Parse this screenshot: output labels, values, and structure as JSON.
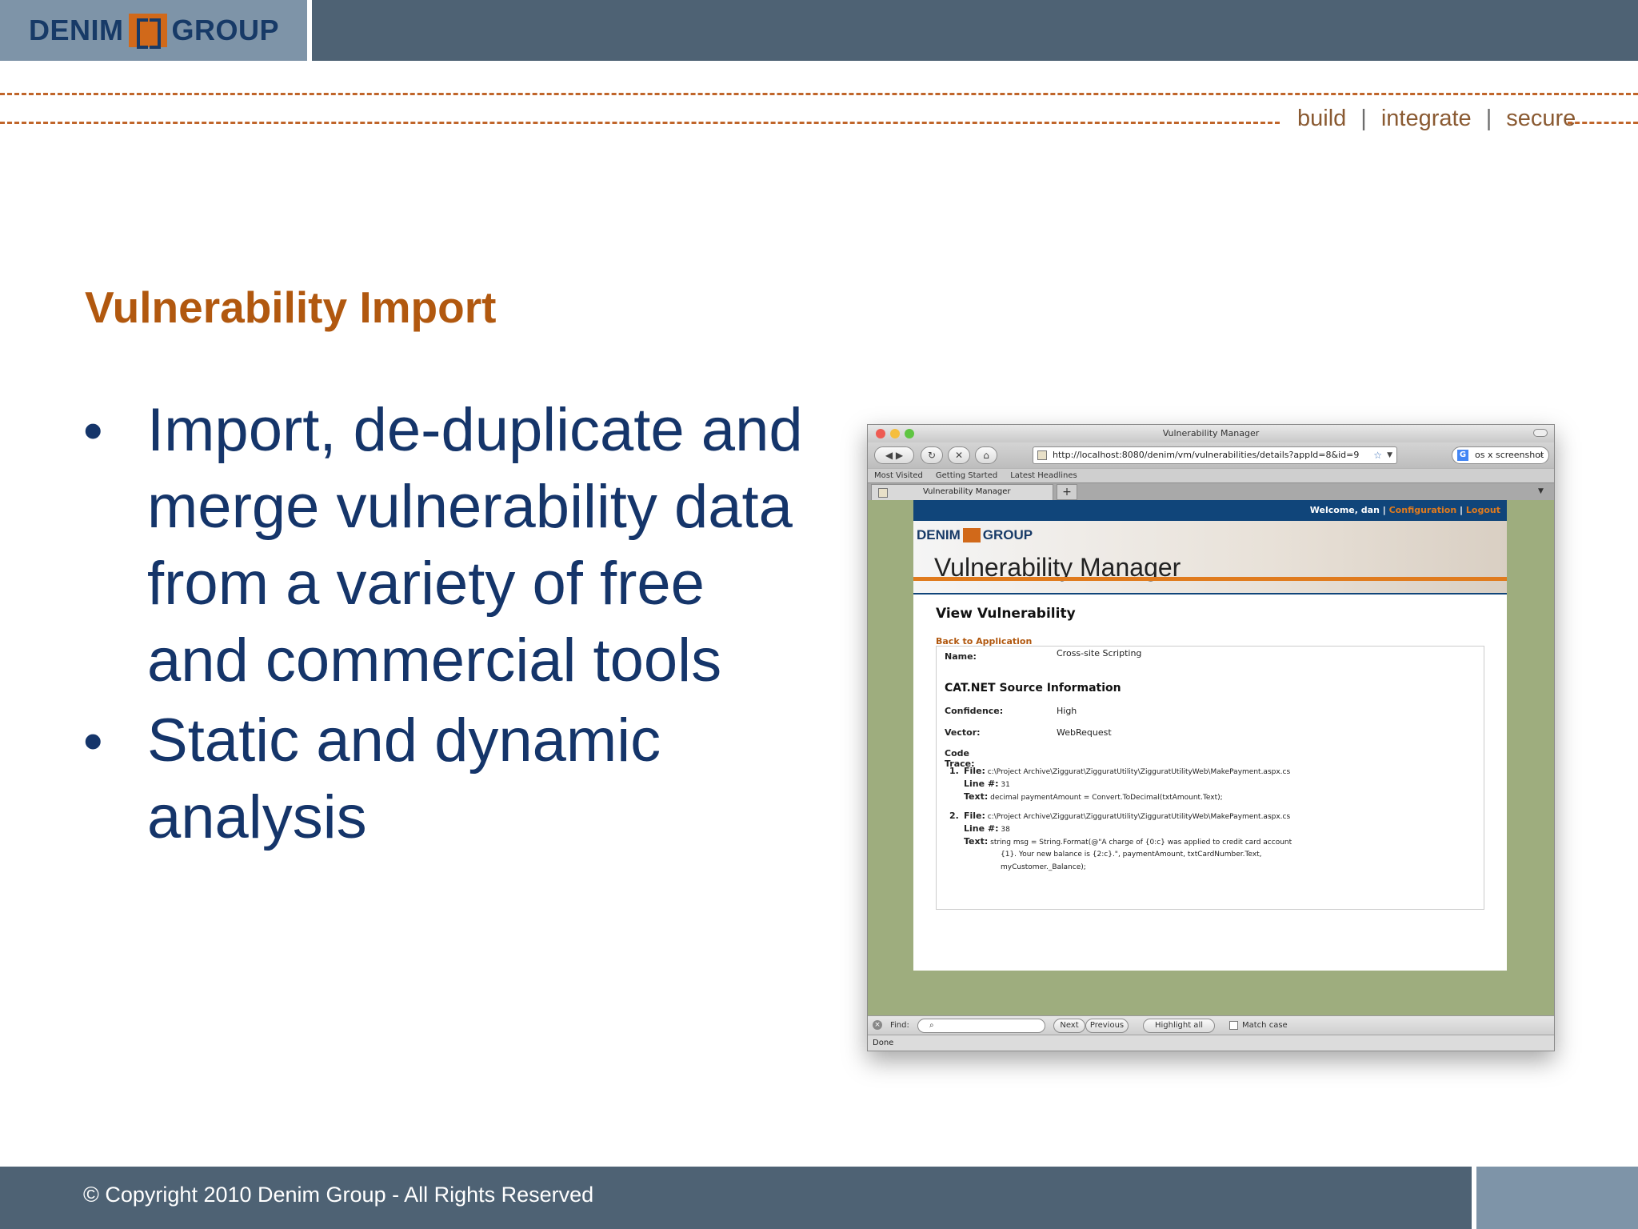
{
  "header": {
    "logo_left": "DENIM",
    "logo_right": "GROUP",
    "tagline": [
      "build",
      "integrate",
      "secure"
    ]
  },
  "slide": {
    "title": "Vulnerability Import",
    "bullets": [
      "Import, de-duplicate and merge vulnerability data from a variety of free and commercial tools",
      "Static and dynamic analysis"
    ]
  },
  "footer": {
    "copyright": "© Copyright 2010 Denim Group - All Rights Reserved"
  },
  "browser": {
    "window_title": "Vulnerability Manager",
    "url": "http://localhost:8080/denim/vm/vulnerabilities/details?appId=8&id=9",
    "search_value": "os x screenshot",
    "bookmarks": [
      "Most Visited",
      "Getting Started",
      "Latest Headlines"
    ],
    "tab_label": "Vulnerability Manager",
    "new_tab": "+",
    "status": "Done",
    "find": {
      "label": "Find:",
      "next": "Next",
      "previous": "Previous",
      "highlight": "Highlight all",
      "match_case": "Match case"
    }
  },
  "app": {
    "welcome": "Welcome, dan",
    "configuration": "Configuration",
    "logout": "Logout",
    "logo_left": "DENIM",
    "logo_right": "GROUP",
    "title": "Vulnerability Manager",
    "heading": "View Vulnerability",
    "back_link": "Back to Application",
    "name_label": "Name:",
    "name_value": "Cross-site Scripting",
    "section_title": "CAT.NET Source Information",
    "confidence_label": "Confidence:",
    "confidence_value": "High",
    "vector_label": "Vector:",
    "vector_value": "WebRequest",
    "code_trace_label": "Code Trace:",
    "trace": [
      {
        "num": "1.",
        "file": "c:\\Project Archive\\Ziggurat\\ZigguratUtility\\ZigguratUtilityWeb\\MakePayment.aspx.cs",
        "line": "31",
        "text": "decimal paymentAmount = Convert.ToDecimal(txtAmount.Text);"
      },
      {
        "num": "2.",
        "file": "c:\\Project Archive\\Ziggurat\\ZigguratUtility\\ZigguratUtilityWeb\\MakePayment.aspx.cs",
        "line": "38",
        "text": "string msg = String.Format(@\"A charge of {0:c} was applied to credit card account",
        "text2": "{1}. Your new balance is {2:c}.\", paymentAmount, txtCardNumber.Text,",
        "text3": "myCustomer._Balance);"
      }
    ],
    "file_key": "File:",
    "line_key": "Line #:",
    "text_key": "Text:"
  }
}
